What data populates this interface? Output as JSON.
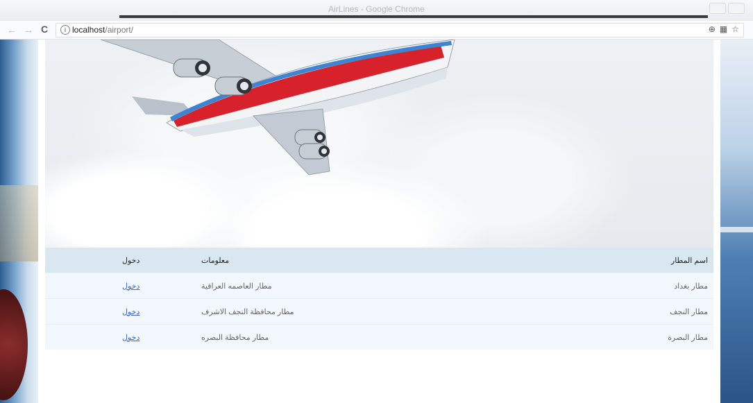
{
  "window": {
    "title": "AirLines - Google Chrome"
  },
  "browser": {
    "url_host": "localhost",
    "url_path": "/airport/"
  },
  "table": {
    "headers": [
      "اسم المطار",
      "معلومات",
      "دخول"
    ],
    "rows": [
      {
        "name": "مطار بغداد",
        "info": "مطار العاصمه العراقية",
        "link": "دخول"
      },
      {
        "name": "مطار النجف",
        "info": "مطار محافظة النجف الاشرف",
        "link": "دخول"
      },
      {
        "name": "مطار البصرة",
        "info": "مطار محافظة البصره",
        "link": "دخول"
      }
    ]
  }
}
